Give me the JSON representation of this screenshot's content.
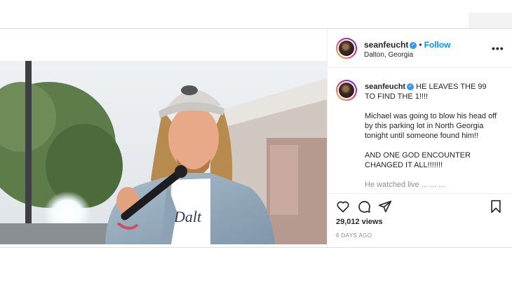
{
  "post": {
    "author": {
      "username": "seanfeucht",
      "verified_glyph": "✓",
      "follow_label": "Follow",
      "separator": "•",
      "location": "Dalton, Georgia"
    },
    "more_label": "•••",
    "caption": {
      "username": "seanfeucht",
      "first_line": "HE LEAVES THE 99 TO FIND THE 1!!!!",
      "paragraphs": [
        "Michael was going to blow his head off by this parking lot in North Georgia tonight until someone found him!!",
        "AND ONE GOD ENCOUNTER CHANGED IT ALL!!!!!!!"
      ],
      "truncated_line": "He watched live ...  ... ..."
    },
    "views": "29,012 views",
    "time_ago": "6 DAYS AGO",
    "icons": {
      "like": "heart-icon",
      "comment": "comment-icon",
      "share": "share-icon",
      "save": "bookmark-icon",
      "mute": "muted-speaker-icon",
      "more": "more-options-icon"
    },
    "colors": {
      "link_blue": "#0095f6",
      "verified_blue": "#3897f0",
      "text": "#262626",
      "muted": "#8e8e8e"
    }
  }
}
